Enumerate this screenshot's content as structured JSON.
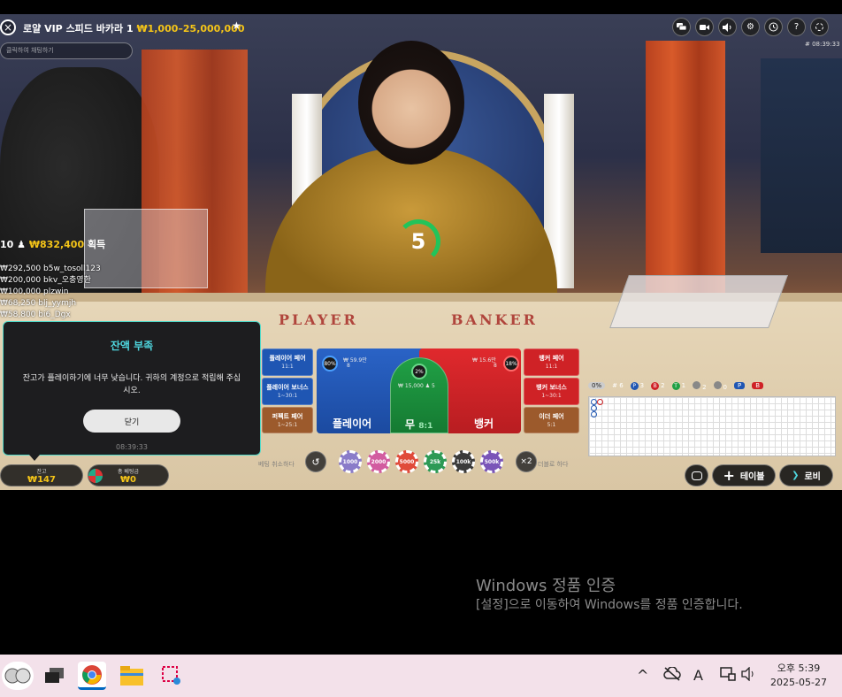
{
  "header": {
    "close_icon": "×",
    "table_name": "로얄 VIP 스피드 바카라 1",
    "limit": "₩1,000–25,000,000",
    "favorite_icon": "star-icon",
    "chat_placeholder": "클릭하여 채팅하기",
    "time": "# 08:39:33",
    "icons": [
      "chat-bubbles-icon",
      "video-icon",
      "volume-icon",
      "settings-icon",
      "history-icon",
      "help-icon",
      "fullscreen-icon"
    ]
  },
  "timer": {
    "value": "5"
  },
  "winners": {
    "count": "10",
    "amount": "₩832,400",
    "label": "획득",
    "list": [
      {
        "amount": "₩292,500",
        "name": "b5w_tosoll123"
      },
      {
        "amount": "₩200,000",
        "name": "bkv_오충영한"
      },
      {
        "amount": "₩100,000",
        "name": "plzwin"
      },
      {
        "amount": "₩68,250",
        "name": "blj_yymjh"
      },
      {
        "amount": "₩58,800",
        "name": "bi6_Dgx"
      }
    ]
  },
  "table_text": {
    "player": "PLAYER",
    "banker": "BANKER"
  },
  "dialog": {
    "title": "잔액 부족",
    "message": "잔고가 플레이하기에 너무 낮습니다. 귀하의 계정으로 적립해 주십시오.",
    "button": "닫기",
    "time": "08:39:33"
  },
  "balance": {
    "label": "잔고",
    "value": "₩147"
  },
  "total_bet": {
    "label": "총 베팅금",
    "value": "₩0"
  },
  "side_bets": {
    "player_pair": {
      "label": "플레이어 페어",
      "odds": "11:1"
    },
    "player_bonus": {
      "label": "플레이어 보너스",
      "odds": "1~30:1"
    },
    "perfect_pair": {
      "label": "퍼펙트 페어",
      "odds": "1~25:1"
    },
    "banker_pair": {
      "label": "뱅커 페어",
      "odds": "11:1"
    },
    "banker_bonus": {
      "label": "뱅커 보너스",
      "odds": "1~30:1"
    },
    "either_pair": {
      "label": "이더 페어",
      "odds": "5:1"
    }
  },
  "main_bets": {
    "player": {
      "label": "플레이어",
      "percent": "80%",
      "amount": "₩ 59.9만",
      "count": "8"
    },
    "tie": {
      "label": "무",
      "odds": "8:1",
      "percent": "2%",
      "amount": "₩ 15,000",
      "count": "5"
    },
    "banker": {
      "label": "뱅커",
      "percent": "18%",
      "amount": "₩ 15.6만",
      "count": "8"
    }
  },
  "chips_row": {
    "undo_icon": "↺",
    "cancel_text": "베팅 취소하다",
    "chips": [
      {
        "label": "1000",
        "color": "#8a7cc9"
      },
      {
        "label": "2000",
        "color": "#d25ca0"
      },
      {
        "label": "5000",
        "color": "#e04a3a"
      },
      {
        "label": "25k",
        "color": "#2c9a55"
      },
      {
        "label": "100k",
        "color": "#3a3a3a"
      },
      {
        "label": "500k",
        "color": "#7a55b8"
      }
    ],
    "double_label": "×2",
    "double_text": "더블로 하다"
  },
  "roadmap": {
    "percent": "0%",
    "total": "# 6",
    "player": {
      "label": "P",
      "count": "3",
      "color": "#1f56b3"
    },
    "banker": {
      "label": "B",
      "count": "2",
      "color": "#cf2226"
    },
    "tie": {
      "label": "T",
      "count": "1",
      "color": "#20a045"
    },
    "ppair": "2",
    "bpair": "0",
    "predict_p": "P",
    "predict_b": "B"
  },
  "bottom_right": {
    "toggle_icon": "chat-icon",
    "add_table": "테이블",
    "lobby": "로비"
  },
  "watermark": {
    "line1": "Windows 정품 인증",
    "line2": "[설정]으로 이동하여 Windows를 정품 인증합니다."
  },
  "taskbar": {
    "time": "오후 5:39",
    "date": "2025-05-27"
  }
}
